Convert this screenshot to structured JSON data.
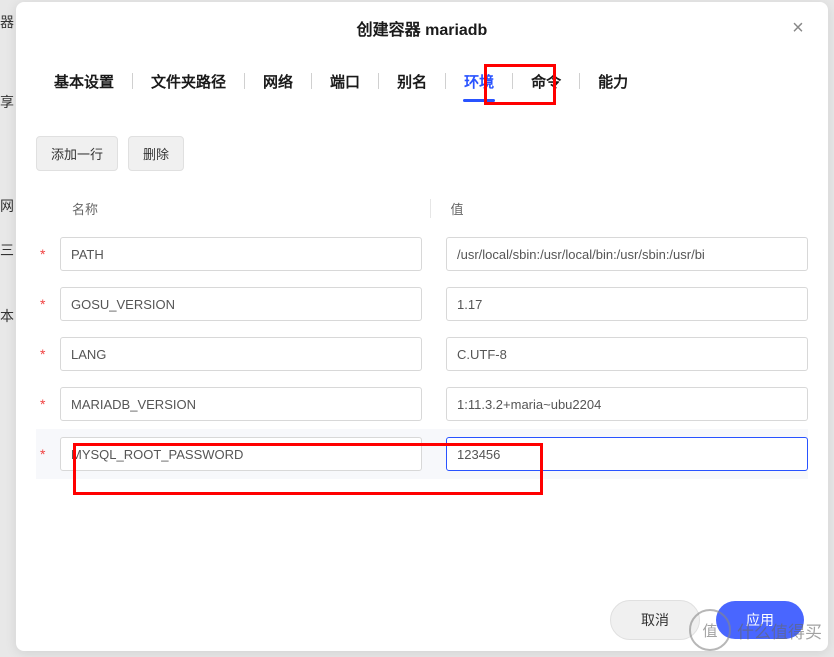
{
  "modal": {
    "title": "创建容器 mariadb",
    "close_icon": "×"
  },
  "tabs": [
    {
      "label": "基本设置",
      "key": "basic"
    },
    {
      "label": "文件夹路径",
      "key": "folder"
    },
    {
      "label": "网络",
      "key": "network"
    },
    {
      "label": "端口",
      "key": "port"
    },
    {
      "label": "别名",
      "key": "alias"
    },
    {
      "label": "环境",
      "key": "env",
      "active": true
    },
    {
      "label": "命令",
      "key": "cmd"
    },
    {
      "label": "能力",
      "key": "cap"
    }
  ],
  "toolbar": {
    "add_label": "添加一行",
    "delete_label": "删除"
  },
  "table": {
    "header_name": "名称",
    "header_value": "值",
    "rows": [
      {
        "name": "PATH",
        "value": "/usr/local/sbin:/usr/local/bin:/usr/sbin:/usr/bi"
      },
      {
        "name": "GOSU_VERSION",
        "value": "1.17"
      },
      {
        "name": "LANG",
        "value": "C.UTF-8"
      },
      {
        "name": "MARIADB_VERSION",
        "value": "1:11.3.2+maria~ubu2204"
      },
      {
        "name": "MYSQL_ROOT_PASSWORD",
        "value": "123456",
        "selected": true,
        "focused": true
      }
    ]
  },
  "footer": {
    "cancel_label": "取消",
    "apply_label": "应用"
  },
  "watermark": {
    "circle": "值",
    "text": "什么值得买"
  },
  "bg": {
    "t1": "器",
    "t2": "享",
    "t3": "网",
    "t4": "三",
    "t5": "本"
  }
}
